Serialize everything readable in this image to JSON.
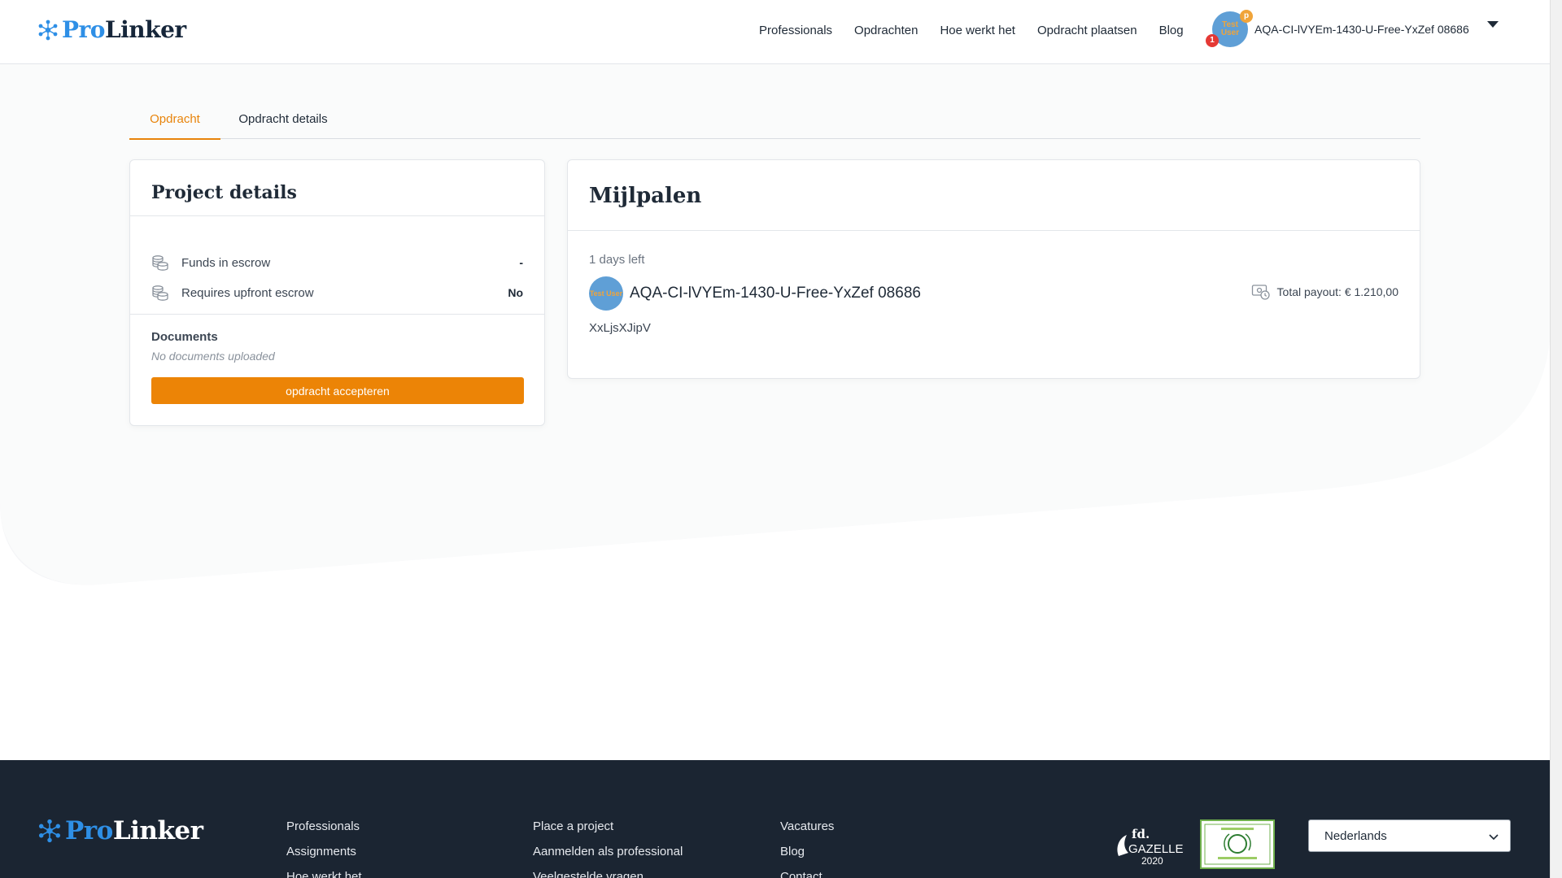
{
  "brand": {
    "pro": "Pro",
    "linker": "Linker"
  },
  "nav": {
    "items": [
      "Professionals",
      "Opdrachten",
      "Hoe werkt het",
      "Opdracht plaatsen",
      "Blog"
    ]
  },
  "user": {
    "name": "AQA-CI-lVYEm-1430-U-Free-YxZef 08686",
    "avatar_text": "Test User",
    "badge_plan": "p",
    "notification_count": "1"
  },
  "tabs": [
    "Opdracht",
    "Opdracht details"
  ],
  "project_details": {
    "title": "Project details",
    "rows": [
      {
        "label": "Funds in escrow",
        "value": "-",
        "icon": "coins-icon"
      },
      {
        "label": "Requires upfront escrow",
        "value": "No",
        "icon": "coins-icon"
      }
    ],
    "documents_label": "Documents",
    "documents_empty": "No documents uploaded",
    "accept_button": "opdracht accepteren"
  },
  "milestones": {
    "title": "Mijlpalen",
    "days_left": "1 days left",
    "name": "AQA-CI-lVYEm-1430-U-Free-YxZef 08686",
    "avatar_text": "Test User",
    "payout": "Total payout: € 1.210,00",
    "description": "XxLjsXJipV"
  },
  "footer": {
    "col1": [
      "Professionals",
      "Assignments",
      "Hoe werkt het"
    ],
    "col2": [
      "Place a project",
      "Aanmelden als professional",
      "Veelgestelde vragen"
    ],
    "col3": [
      "Vacatures",
      "Blog",
      "Contact"
    ],
    "award1": {
      "top": "fd.",
      "name": "GAZELLEN",
      "year": "2020"
    },
    "language": "Nederlands"
  },
  "colors": {
    "accent": "#ec8406",
    "brand_blue": "#2e8fe6",
    "footer_bg": "#1b2532"
  }
}
